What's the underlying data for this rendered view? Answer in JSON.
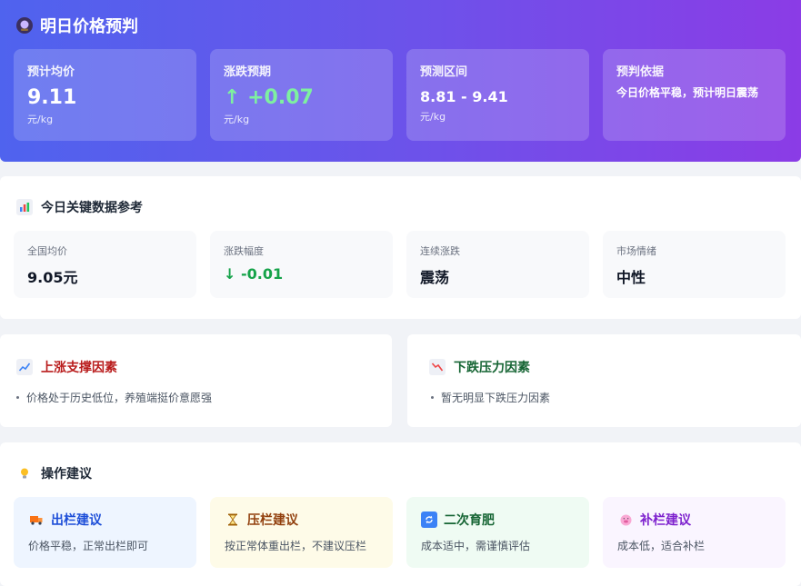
{
  "header": {
    "icon": "crystal-ball-icon",
    "title": "明日价格预判",
    "cards": [
      {
        "label": "预计均价",
        "value": "9.11",
        "unit": "元/kg"
      },
      {
        "label": "涨跌预期",
        "value": "↑ +0.07",
        "unit": "元/kg",
        "color": "#7ef0a0"
      },
      {
        "label": "预测区间",
        "value": "8.81 - 9.41",
        "unit": "元/kg"
      },
      {
        "label": "预判依据",
        "note": "今日价格平稳，预计明日震荡"
      }
    ]
  },
  "key_data": {
    "icon": "bar-chart-icon",
    "title": "今日关键数据参考",
    "cards": [
      {
        "label": "全国均价",
        "value": "9.05元"
      },
      {
        "label": "涨跌幅度",
        "value": "↓ -0.01",
        "color": "#16a34a"
      },
      {
        "label": "连续涨跌",
        "value": "震荡"
      },
      {
        "label": "市场情绪",
        "value": "中性"
      }
    ]
  },
  "factors": {
    "up": {
      "icon": "chart-increasing-icon",
      "title": "上涨支撑因素",
      "color": "#b91c1c",
      "items": [
        "价格处于历史低位，养殖端挺价意愿强"
      ]
    },
    "down": {
      "icon": "chart-decreasing-icon",
      "title": "下跌压力因素",
      "color": "#166534",
      "items": [
        "暂无明显下跌压力因素"
      ]
    }
  },
  "advice": {
    "icon": "light-bulb-icon",
    "title": "操作建议",
    "cards": [
      {
        "icon": "truck-icon",
        "title": "出栏建议",
        "desc": "价格平稳，正常出栏即可",
        "bg": "#eef5ff",
        "color": "#1d4ed8"
      },
      {
        "icon": "hourglass-icon",
        "title": "压栏建议",
        "desc": "按正常体重出栏，不建议压栏",
        "bg": "#fefbe8",
        "color": "#92400e"
      },
      {
        "icon": "cycle-arrows-icon",
        "title": "二次育肥",
        "desc": "成本适中，需谨慎评估",
        "bg": "#effbf3",
        "color": "#166534"
      },
      {
        "icon": "pig-face-icon",
        "title": "补栏建议",
        "desc": "成本低，适合补栏",
        "bg": "#faf5ff",
        "color": "#7e22ce"
      }
    ]
  }
}
